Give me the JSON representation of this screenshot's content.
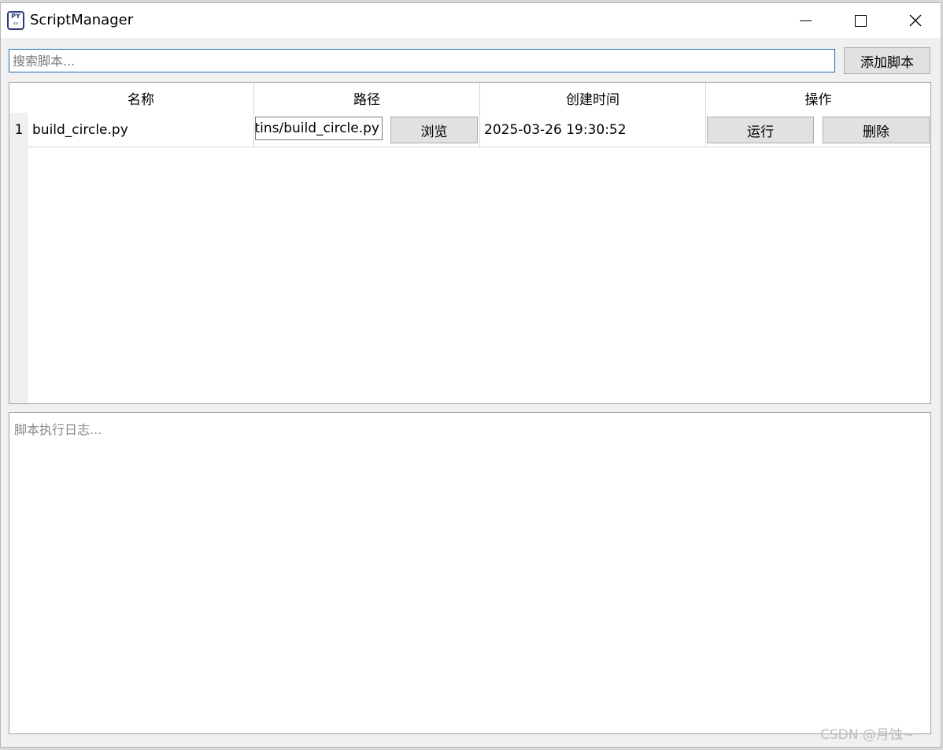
{
  "window": {
    "title": "ScriptManager",
    "icon_name": "python-script-icon",
    "controls": [
      "minimize-icon",
      "maximize-icon",
      "close-icon"
    ]
  },
  "toolbar": {
    "search_placeholder": "搜索脚本...",
    "search_value": "",
    "add_button_label": "添加脚本"
  },
  "table": {
    "columns": [
      "名称",
      "路径",
      "创建时间",
      "操作"
    ],
    "rows": [
      {
        "index": "1",
        "name": "build_circle.py",
        "path": "tins/build_circle.py",
        "browse_label": "浏览",
        "created": "2025-03-26 19:30:52",
        "run_label": "运行",
        "delete_label": "删除"
      }
    ]
  },
  "log": {
    "placeholder": "脚本执行日志..."
  },
  "watermark": "CSDN @月蚀~",
  "colors": {
    "accent_border": "#1f6cb5",
    "button_bg": "#e1e1e1",
    "window_bg": "#f0f0f0"
  }
}
